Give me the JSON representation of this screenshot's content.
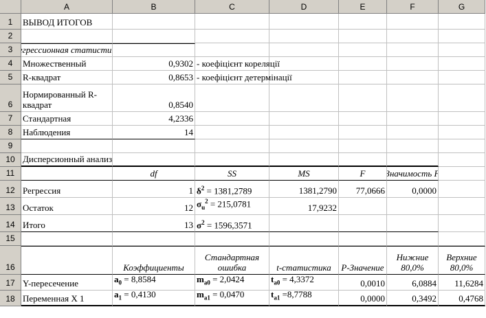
{
  "columns": [
    "A",
    "B",
    "C",
    "D",
    "E",
    "F",
    "G"
  ],
  "rows": [
    "1",
    "2",
    "3",
    "4",
    "5",
    "6",
    "7",
    "8",
    "9",
    "10",
    "11",
    "12",
    "13",
    "14",
    "15",
    "16",
    "17",
    "18"
  ],
  "cells": {
    "A1": "ВЫВОД ИТОГОВ",
    "A3": "Регрессионная статистика",
    "A4": "Множественный",
    "B4": "0,9302",
    "C4": "- коефіцієнт кореляції",
    "A5": "R-квадрат",
    "B5": "0,8653",
    "C5": "- коефіцієнт детермінації",
    "A6": "Нормированный R-квадрат",
    "B6": "0,8540",
    "A7": "Стандартная",
    "B7": "4,2336",
    "A8": "Наблюдения",
    "B8": "14",
    "A10": "Дисперсионный анализ",
    "B11": "df",
    "C11": "SS",
    "D11": "MS",
    "E11": "F",
    "F11": "Значимость F",
    "A12": "Регрессия",
    "B12": "1",
    "C12": {
      "sym": "δ",
      "sub": "",
      "sup": "2",
      "rest": " = 1381,2789"
    },
    "D12": "1381,2790",
    "E12": "77,0666",
    "F12": "0,0000",
    "A13": "Остаток",
    "B13": "12",
    "C13": {
      "sym": "σ",
      "sub": "u",
      "sup": "2",
      "rest": " = 215,0781"
    },
    "D13": "17,9232",
    "A14": "Итого",
    "B14": "13",
    "C14": {
      "sym": "σ",
      "sub": "",
      "sup": "2",
      "rest": " = 1596,3571"
    },
    "B16": "Коэффициенты",
    "C16": "Стандартная ошибка",
    "D16": "t-статистика",
    "E16": "P-Значение",
    "F16": "Нижние 80,0%",
    "G16": "Верхние 80,0%",
    "A17": "Y-пересечение",
    "B17": {
      "sym": "a",
      "sub": "0",
      "sup": "",
      "rest": " = 8,8584"
    },
    "C17": {
      "sym": "m",
      "sub": "a0",
      "sup": "",
      "rest": " = 2,0424"
    },
    "D17": {
      "sym": "t",
      "sub": "a0",
      "sup": "",
      "rest": " = 4,3372"
    },
    "E17": "0,0010",
    "F17": "6,0884",
    "G17": "11,6284",
    "A18": "Переменная X 1",
    "B18": {
      "sym": "a",
      "sub": "1",
      "sup": "",
      "rest": " = 0,4130"
    },
    "C18": {
      "sym": "m",
      "sub": "a1",
      "sup": "",
      "rest": " = 0,0470"
    },
    "D18": {
      "sym": "t",
      "sub": "a1",
      "sup": "",
      "rest": " =8,7788"
    },
    "E18": "0,0000",
    "F18": "0,3492",
    "G18": "0,4768"
  }
}
